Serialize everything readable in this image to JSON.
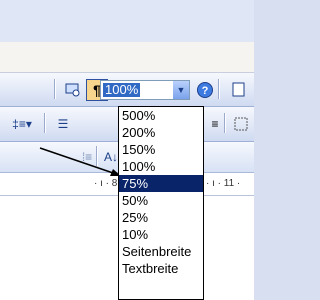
{
  "toolbar": {
    "zoom_value": "100%",
    "pilcrow": "¶"
  },
  "zoom_dropdown": {
    "options": [
      "500%",
      "200%",
      "150%",
      "100%",
      "75%",
      "50%",
      "25%",
      "10%",
      "Seitenbreite",
      "Textbreite"
    ],
    "selected": "75%"
  },
  "ruler": {
    "left_ticks": "· ı · 8 ·",
    "right_ticks": "· ı · 11 ·"
  },
  "colors": {
    "selection": "#0a246a",
    "zoom_highlight": "#316ac5",
    "pressed_button": "#f8d58c"
  }
}
